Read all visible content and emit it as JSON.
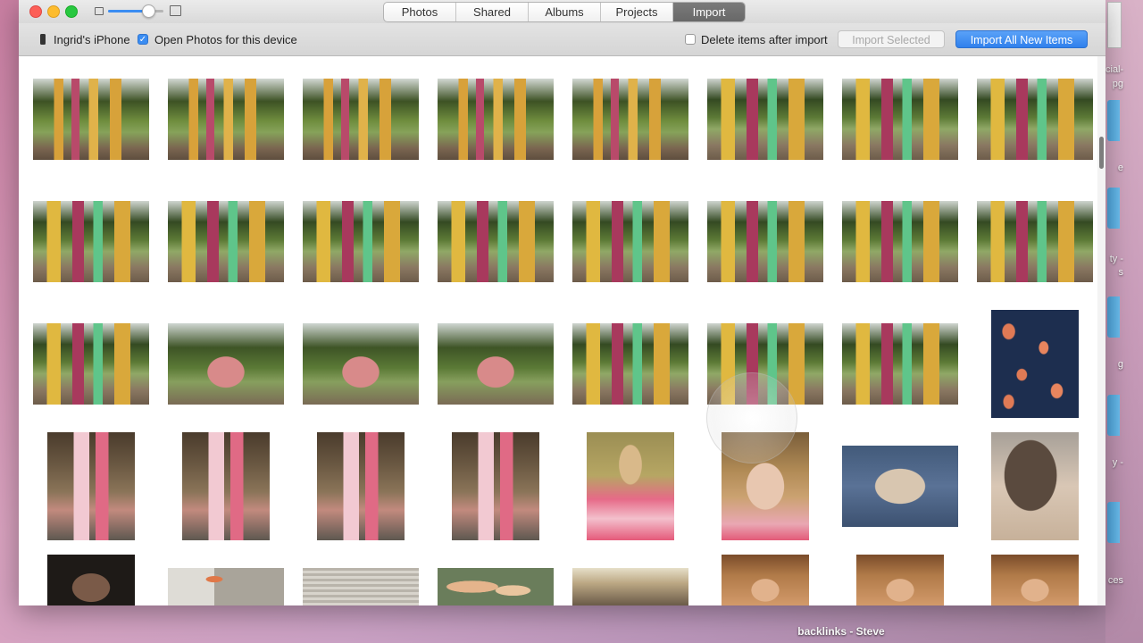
{
  "window": {
    "tabs": [
      {
        "label": "Photos",
        "active": false
      },
      {
        "label": "Shared",
        "active": false
      },
      {
        "label": "Albums",
        "active": false
      },
      {
        "label": "Projects",
        "active": false
      },
      {
        "label": "Import",
        "active": true
      }
    ],
    "zoom_level": 0.72
  },
  "import_bar": {
    "device_name": "Ingrid's iPhone",
    "open_photos_label": "Open Photos for this device",
    "open_photos_checked": true,
    "delete_items_label": "Delete items after import",
    "delete_items_checked": false,
    "import_selected_label": "Import Selected",
    "import_all_label": "Import All New Items"
  },
  "desktop": {
    "right_labels": [
      "cial-",
      "pg",
      "e",
      "ty -",
      "s",
      "g",
      "y -",
      "ces"
    ],
    "bottom_label": "backlinks - Steve"
  },
  "accent_color": "#2f80ec"
}
